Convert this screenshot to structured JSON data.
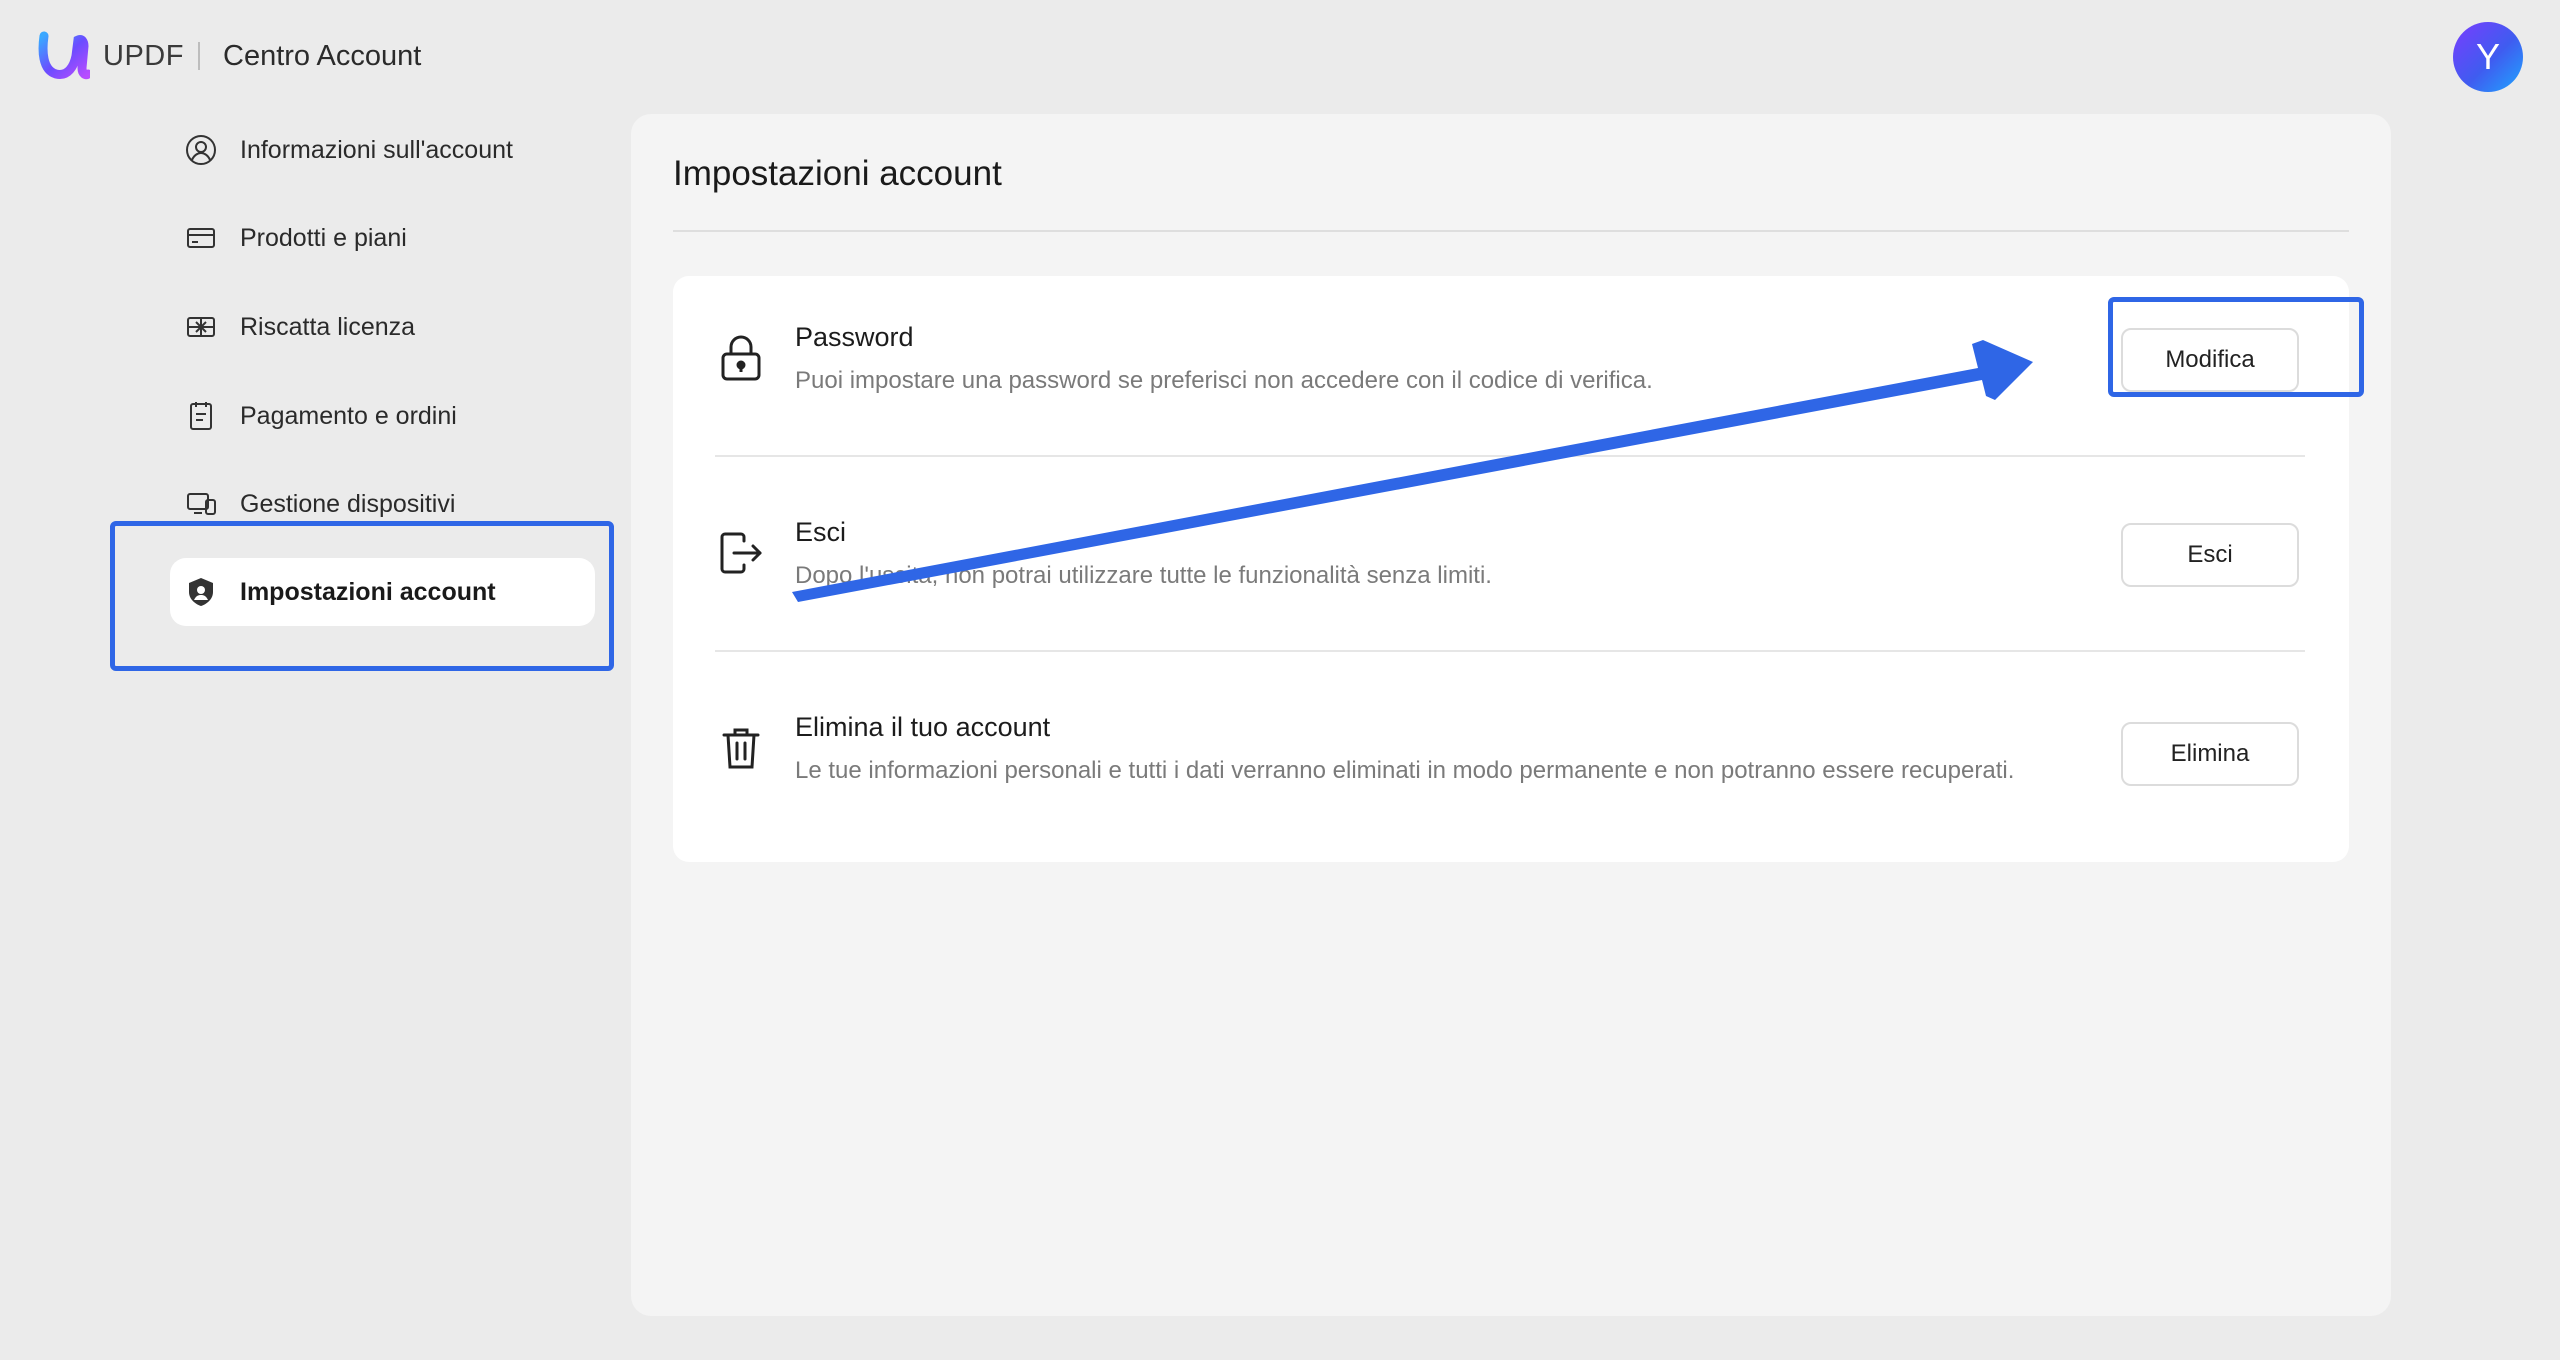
{
  "header": {
    "brand": "UPDF",
    "app_title": "Centro Account",
    "avatar_initial": "Y"
  },
  "sidebar": {
    "items": [
      {
        "label": "Informazioni sull'account",
        "icon": "user-circle-icon"
      },
      {
        "label": "Prodotti e piani",
        "icon": "card-icon"
      },
      {
        "label": "Riscatta licenza",
        "icon": "gift-icon"
      },
      {
        "label": "Pagamento e ordini",
        "icon": "receipt-icon"
      },
      {
        "label": "Gestione dispositivi",
        "icon": "devices-icon"
      },
      {
        "label": "Impostazioni account",
        "icon": "shield-user-icon",
        "active": true
      }
    ]
  },
  "main": {
    "title": "Impostazioni account",
    "rows": [
      {
        "icon": "lock-icon",
        "title": "Password",
        "description": "Puoi impostare una password se preferisci non accedere con il codice di verifica.",
        "button": "Modifica"
      },
      {
        "icon": "logout-icon",
        "title": "Esci",
        "description": "Dopo l'uscita, non potrai utilizzare tutte le funzionalità senza limiti.",
        "button": "Esci"
      },
      {
        "icon": "trash-icon",
        "title": "Elimina il tuo account",
        "description": "Le tue informazioni personali e tutti i dati verranno eliminati in modo permanente e non potranno essere recuperati.",
        "button": "Elimina"
      }
    ]
  },
  "colors": {
    "annotation": "#2f66e6",
    "background": "#ebebeb",
    "panel": "#f4f4f4"
  }
}
